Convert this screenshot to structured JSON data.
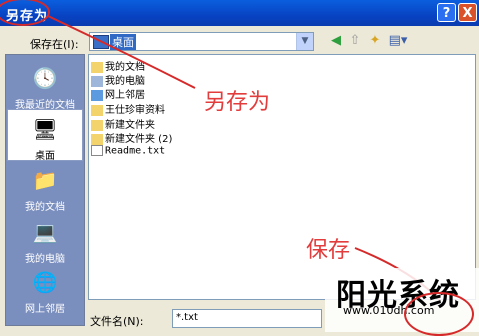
{
  "title": "另存为",
  "title_buttons": {
    "help": "?",
    "close": "X"
  },
  "lookin": {
    "label": "保存在(I):",
    "value": "桌面"
  },
  "places": [
    {
      "label": "我最近的文档"
    },
    {
      "label": "桌面"
    },
    {
      "label": "我的文档"
    },
    {
      "label": "我的电脑"
    },
    {
      "label": "网上邻居"
    }
  ],
  "files": [
    {
      "name": "我的文档",
      "icon": "my-documents-icon"
    },
    {
      "name": "我的电脑",
      "icon": "my-computer-icon"
    },
    {
      "name": "网上邻居",
      "icon": "network-icon"
    },
    {
      "name": "王仕珍审资料",
      "icon": "folder-icon"
    },
    {
      "name": "新建文件夹",
      "icon": "folder-icon"
    },
    {
      "name": "新建文件夹 (2)",
      "icon": "folder-icon"
    },
    {
      "name": "Readme.txt",
      "icon": "text-file-icon"
    }
  ],
  "filename": {
    "label": "文件名(N):",
    "value": "*.txt"
  },
  "annotations": {
    "save_as": "另存为",
    "save": "保存"
  },
  "watermark": {
    "title": "阳光系统",
    "url": "www.010dh.com"
  },
  "colors": {
    "titlebar": "#0a5fde",
    "annotation": "#e23c3c",
    "places_bar": "#7b8fbf"
  }
}
